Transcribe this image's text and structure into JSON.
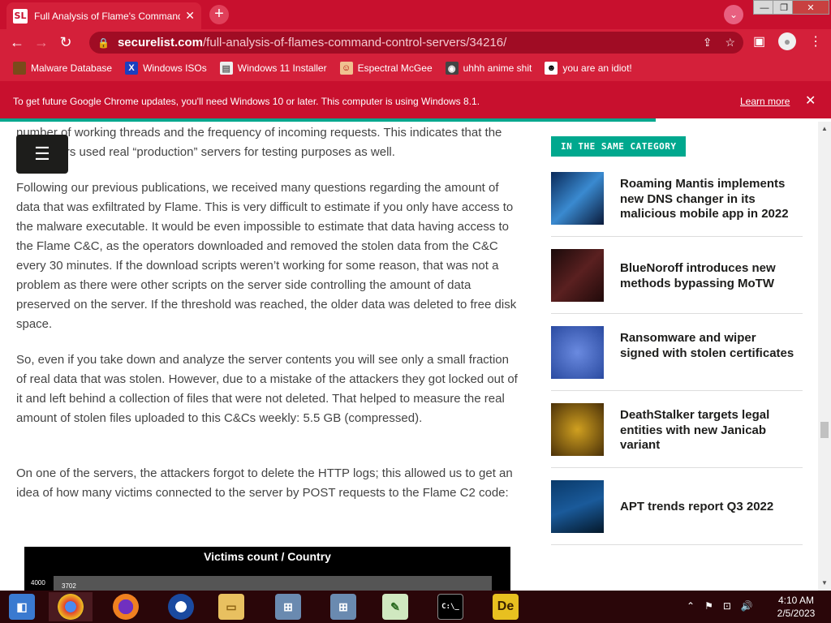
{
  "browser": {
    "tab_title": "Full Analysis of Flame's Command",
    "favicon_text": "SL",
    "tab_close": "✕",
    "new_tab": "+",
    "url_host": "securelist.com",
    "url_path": "/full-analysis-of-flames-command-control-servers/34216/",
    "window_controls": {
      "minimize": "—",
      "maximize": "❐",
      "close": "✕"
    },
    "theme_color": "#c8102e"
  },
  "bookmarks": [
    {
      "label": "Malware Database",
      "icon": "malware-icon",
      "color": "#7a4a1a"
    },
    {
      "label": "Windows ISOs",
      "icon": "x-icon",
      "color": "#1a3fbf"
    },
    {
      "label": "Windows 11 Installer",
      "icon": "doc-icon",
      "color": "#eeeeee"
    },
    {
      "label": "Espectral McGee",
      "icon": "avatar-icon",
      "color": "#f0c090"
    },
    {
      "label": "uhhh anime shit",
      "icon": "anime-icon",
      "color": "#444444"
    },
    {
      "label": "you are an idiot!",
      "icon": "face-icon",
      "color": "#ffffff"
    }
  ],
  "infobar": {
    "message": "To get future Google Chrome updates, you'll need Windows 10 or later. This computer is using Windows 8.1.",
    "learn_more": "Learn more",
    "close": "✕"
  },
  "article": {
    "p0": "number of working threads and the frequency of incoming requests. This indicates that the developers used real “production” servers for testing purposes as well.",
    "p1": "Following our previous publications, we received many questions regarding the amount of data that was exfiltrated by Flame. This is very difficult to estimate if you only have access to the malware executable. It would be even impossible to estimate that data having access to the Flame C&C, as the operators downloaded and removed the stolen data from the C&C every 30 minutes. If the download scripts weren’t working for some reason, that was not a problem as there were other scripts on the server side controlling the amount of data preserved on the server. If the threshold was reached, the older data was deleted to free disk space.",
    "p2": "So, even if you take down and analyze the server contents you will see only a small fraction of real data that was stolen. However, due to a mistake of the attackers they got locked out of it and left behind a collection of files that were not deleted. That helped to measure the real amount of stolen files uploaded to this C&Cs weekly: 5.5 GB (compressed).",
    "p3": "On one of the servers, the attackers forgot to delete the HTTP logs; this allowed us to get an idea of how many victims connected to the server by POST requests to the Flame C2 code:",
    "chart_title": "Victims count / Country",
    "chart_y_tick": "4000",
    "chart_bar_label": "3702"
  },
  "sidebar": {
    "category_label": "IN THE SAME CATEGORY",
    "items": [
      {
        "title": "Roaming Mantis implements new DNS changer in its malicious mobile app in 2022",
        "thumb_color": "#1a4a7a"
      },
      {
        "title": "BlueNoroff introduces new methods bypassing MoTW",
        "thumb_color": "#3a1a1a"
      },
      {
        "title": "Ransomware and wiper signed with stolen certificates",
        "thumb_color": "#2a4aa0"
      },
      {
        "title": "DeathStalker targets legal entities with new Janicab variant",
        "thumb_color": "#5a4010"
      },
      {
        "title": "APT trends report Q3 2022",
        "thumb_color": "#0a2a4a"
      }
    ]
  },
  "taskbar": {
    "time": "4:10 AM",
    "date": "2/5/2023",
    "apps": [
      {
        "name": "start",
        "label": ""
      },
      {
        "name": "chrome",
        "label": ""
      },
      {
        "name": "firefox",
        "label": ""
      },
      {
        "name": "obama",
        "label": ""
      },
      {
        "name": "explorer",
        "label": ""
      },
      {
        "name": "network-1",
        "label": ""
      },
      {
        "name": "network-2",
        "label": ""
      },
      {
        "name": "notepad",
        "label": ""
      },
      {
        "name": "cmd",
        "label": "C:\\_"
      },
      {
        "name": "de",
        "label": "De"
      }
    ]
  }
}
